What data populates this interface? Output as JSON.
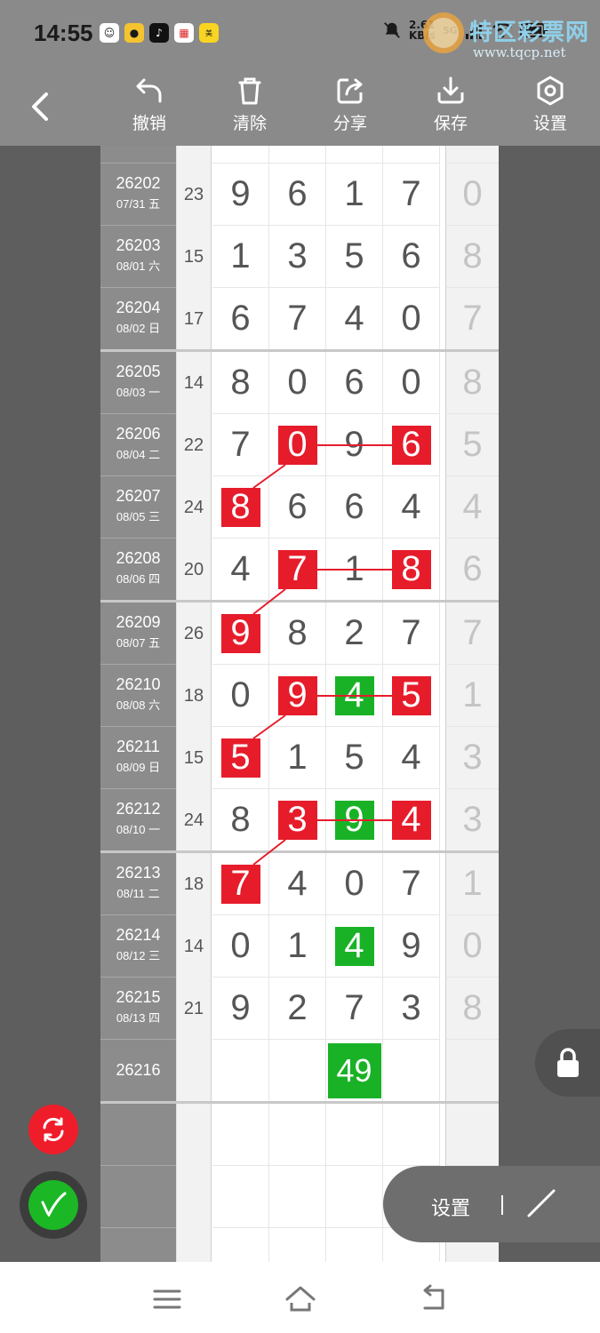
{
  "status_bar": {
    "time": "14:55",
    "network_speed": "2.61",
    "network_unit": "KB/s",
    "network_type": "5G"
  },
  "watermark": {
    "site_name": "特区彩票网",
    "url": "www.tqcp.net"
  },
  "toolbar": {
    "undo": "撤销",
    "clear": "清除",
    "share": "分享",
    "save": "保存",
    "settings": "设置"
  },
  "rows": [
    {
      "id": "26202",
      "date": "07/31 五",
      "sum": "23",
      "d": [
        "9",
        "6",
        "1",
        "7"
      ],
      "last": "0"
    },
    {
      "id": "26203",
      "date": "08/01 六",
      "sum": "15",
      "d": [
        "1",
        "3",
        "5",
        "6"
      ],
      "last": "8"
    },
    {
      "id": "26204",
      "date": "08/02 日",
      "sum": "17",
      "d": [
        "6",
        "7",
        "4",
        "0"
      ],
      "last": "7"
    },
    {
      "id": "26205",
      "date": "08/03 一",
      "sum": "14",
      "d": [
        "8",
        "0",
        "6",
        "0"
      ],
      "last": "8"
    },
    {
      "id": "26206",
      "date": "08/04 二",
      "sum": "22",
      "d": [
        "7",
        "0",
        "9",
        "6"
      ],
      "last": "5"
    },
    {
      "id": "26207",
      "date": "08/05 三",
      "sum": "24",
      "d": [
        "8",
        "6",
        "6",
        "4"
      ],
      "last": "4"
    },
    {
      "id": "26208",
      "date": "08/06 四",
      "sum": "20",
      "d": [
        "4",
        "7",
        "1",
        "8"
      ],
      "last": "6"
    },
    {
      "id": "26209",
      "date": "08/07 五",
      "sum": "26",
      "d": [
        "9",
        "8",
        "2",
        "7"
      ],
      "last": "7"
    },
    {
      "id": "26210",
      "date": "08/08 六",
      "sum": "18",
      "d": [
        "0",
        "9",
        "4",
        "5"
      ],
      "last": "1"
    },
    {
      "id": "26211",
      "date": "08/09 日",
      "sum": "15",
      "d": [
        "5",
        "1",
        "5",
        "4"
      ],
      "last": "3"
    },
    {
      "id": "26212",
      "date": "08/10 一",
      "sum": "24",
      "d": [
        "8",
        "3",
        "9",
        "4"
      ],
      "last": "3"
    },
    {
      "id": "26213",
      "date": "08/11 二",
      "sum": "18",
      "d": [
        "7",
        "4",
        "0",
        "7"
      ],
      "last": "1"
    },
    {
      "id": "26214",
      "date": "08/12 三",
      "sum": "14",
      "d": [
        "0",
        "1",
        "4",
        "9"
      ],
      "last": "0"
    },
    {
      "id": "26215",
      "date": "08/13 四",
      "sum": "21",
      "d": [
        "9",
        "2",
        "7",
        "3"
      ],
      "last": "8"
    }
  ],
  "next_row": {
    "id": "26216",
    "value": "49"
  },
  "overlay": {
    "settings_label": "设置"
  },
  "colors": {
    "highlight_red": "#e61c2b",
    "highlight_green": "#19b226",
    "toolbar_bg": "#8a8a8a"
  }
}
